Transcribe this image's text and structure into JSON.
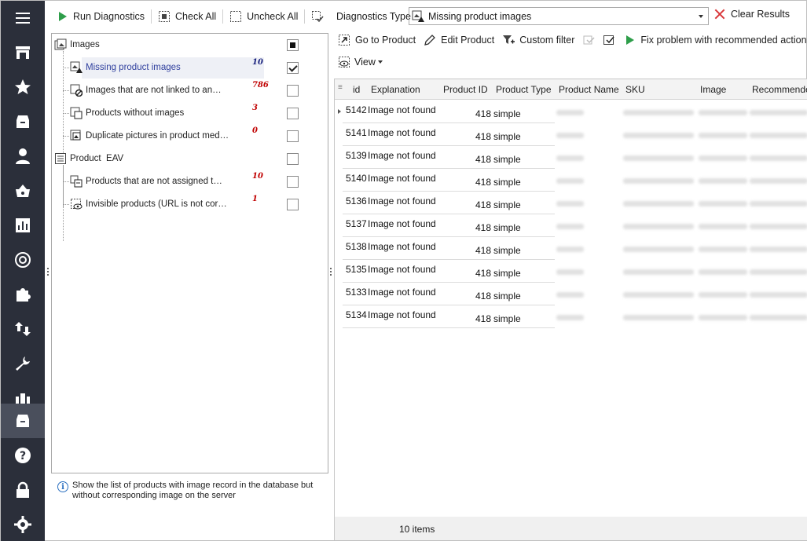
{
  "nav": {
    "items": [
      {
        "icon": "menu-icon"
      },
      {
        "icon": "store-icon"
      },
      {
        "icon": "star-icon"
      },
      {
        "icon": "box-icon"
      },
      {
        "icon": "user-icon"
      },
      {
        "icon": "basket-icon"
      },
      {
        "icon": "chart-icon"
      },
      {
        "icon": "openai-icon"
      },
      {
        "icon": "puzzle-icon"
      },
      {
        "icon": "transfer-icon"
      },
      {
        "icon": "wrench-icon"
      },
      {
        "icon": "bars-icon"
      },
      {
        "icon": "archive-icon"
      },
      {
        "icon": "help-icon"
      },
      {
        "icon": "lock-icon"
      },
      {
        "icon": "settings-icon"
      }
    ],
    "active_index": 12
  },
  "left_toolbar": {
    "run": "Run Diagnostics",
    "check_all": "Check All",
    "uncheck_all": "Uncheck All"
  },
  "tree": {
    "images_group": "Images",
    "items_images": [
      {
        "label": "Missing product images",
        "count": "10",
        "checked": true,
        "selected": true
      },
      {
        "label": "Images that are not linked to an…",
        "count": "786",
        "checked": false
      },
      {
        "label": "Products without images",
        "count": "3",
        "checked": false
      },
      {
        "label": "Duplicate pictures in product med…",
        "count": "0",
        "checked": false
      }
    ],
    "eav_group": "Product  EAV",
    "items_eav": [
      {
        "label": "Products that are not assigned t…",
        "count": "10",
        "checked": false
      },
      {
        "label": "Invisible products (URL is not cor…",
        "count": "1",
        "checked": false
      }
    ]
  },
  "info_text": "Show the list of products with image record in the database but without corresponding image on the server",
  "diagnostics": {
    "type_label": "Diagnostics Type",
    "selected": "Missing product images",
    "clear": "Clear Results"
  },
  "right_toolbar": {
    "go_to_product": "Go to Product",
    "edit_product": "Edit Product",
    "custom_filter": "Custom filter",
    "fix": "Fix problem with recommended action",
    "view": "View"
  },
  "grid": {
    "columns": [
      "id",
      "Explanation",
      "Product ID",
      "Product Type",
      "Product Name",
      "SKU",
      "Image",
      "Recommende"
    ],
    "rows": [
      {
        "id": "5142",
        "explanation": "Image not found",
        "product_id": "418",
        "type": "simple"
      },
      {
        "id": "5141",
        "explanation": "Image not found",
        "product_id": "418",
        "type": "simple"
      },
      {
        "id": "5139",
        "explanation": "Image not found",
        "product_id": "418",
        "type": "simple"
      },
      {
        "id": "5140",
        "explanation": "Image not found",
        "product_id": "418",
        "type": "simple"
      },
      {
        "id": "5136",
        "explanation": "Image not found",
        "product_id": "418",
        "type": "simple"
      },
      {
        "id": "5137",
        "explanation": "Image not found",
        "product_id": "418",
        "type": "simple"
      },
      {
        "id": "5138",
        "explanation": "Image not found",
        "product_id": "418",
        "type": "simple"
      },
      {
        "id": "5135",
        "explanation": "Image not found",
        "product_id": "418",
        "type": "simple"
      },
      {
        "id": "5133",
        "explanation": "Image not found",
        "product_id": "418",
        "type": "simple"
      },
      {
        "id": "5134",
        "explanation": "Image not found",
        "product_id": "418",
        "type": "simple"
      }
    ],
    "footer": "10 items"
  },
  "colors": {
    "rail": "#2b2f3a",
    "rail_active": "#4a4f5c",
    "green": "#2e9e4a",
    "count_red": "#c00000"
  }
}
